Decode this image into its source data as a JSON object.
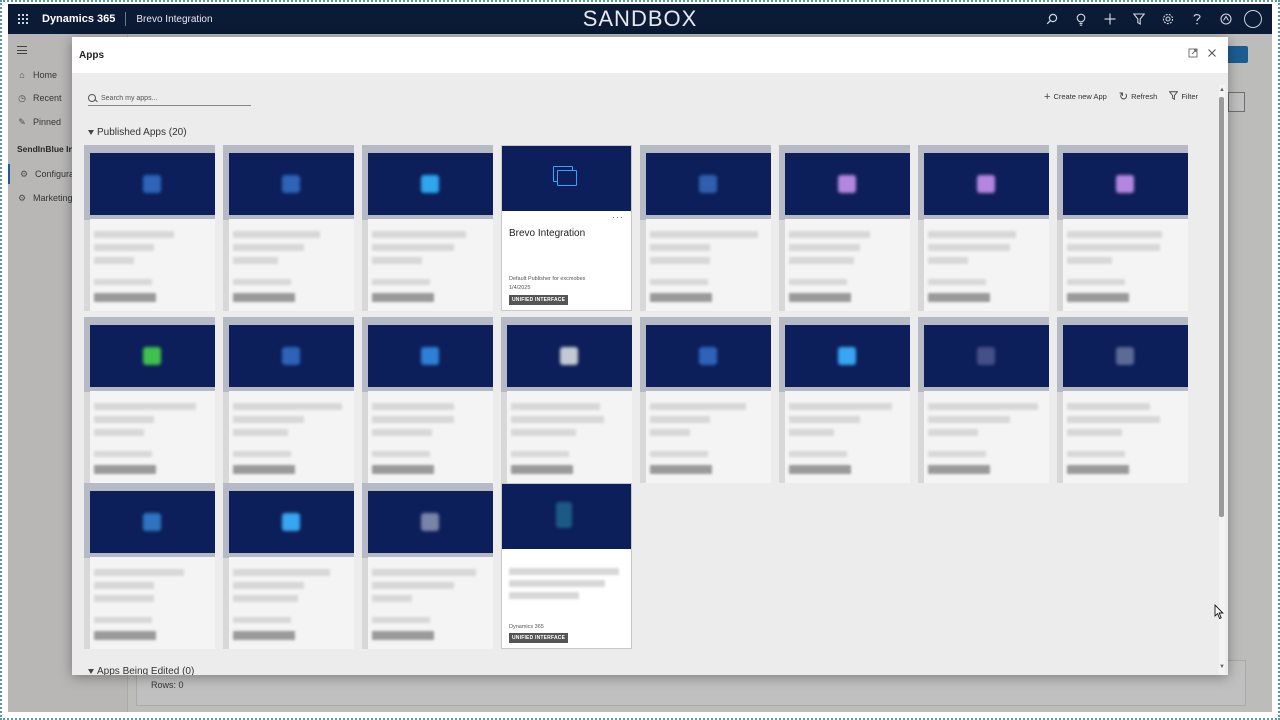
{
  "topbar": {
    "brand": "Dynamics 365",
    "app_name": "Brevo Integration",
    "environment": "SANDBOX",
    "icons": [
      "search-icon",
      "lightbulb-icon",
      "plus-icon",
      "filter-icon",
      "gear-icon",
      "help-icon",
      "copilot-icon",
      "avatar"
    ]
  },
  "sidebar": {
    "items": [
      {
        "label": "Home",
        "icon": "home-icon"
      },
      {
        "label": "Recent",
        "icon": "clock-icon"
      },
      {
        "label": "Pinned",
        "icon": "pin-icon"
      }
    ],
    "group_label": "SendInBlue Int",
    "group_items": [
      {
        "label": "Configura",
        "icon": "gear-icon"
      },
      {
        "label": "Marketing",
        "icon": "gear-icon"
      }
    ]
  },
  "page": {
    "rows_label": "Rows: 0"
  },
  "modal": {
    "title": "Apps",
    "search_placeholder": "Search my apps...",
    "actions": {
      "create": "Create new App",
      "refresh": "Refresh",
      "filter": "Filter"
    },
    "published_section": "Published Apps",
    "published_count": "(20)",
    "editing_section": "Apps Being Edited",
    "editing_count": "(0)",
    "featured_app": {
      "title": "Brevo Integration",
      "publisher": "Default Publisher for excmobes",
      "date": "1/4/2025",
      "badge": "UNIFIED INTERFACE",
      "more": "···"
    },
    "other_card": {
      "publisher": "Dynamics 365",
      "badge": "UNIFIED INTERFACE"
    },
    "card_icon_colors": [
      "#2f63b8",
      "#2f63b8",
      "#2fa6ee",
      "featured",
      "#2f5fb0",
      "#b486e0",
      "#b486e0",
      "#b486e0",
      "#3fc14f",
      "#2f63b8",
      "#2f7fd8",
      "#c4cad4",
      "#2f63b8",
      "#38a6f2",
      "#454f88",
      "#5c6a96",
      "#2f74c0",
      "#39a6f2",
      "#7a84a8",
      "#1c5a86"
    ]
  }
}
